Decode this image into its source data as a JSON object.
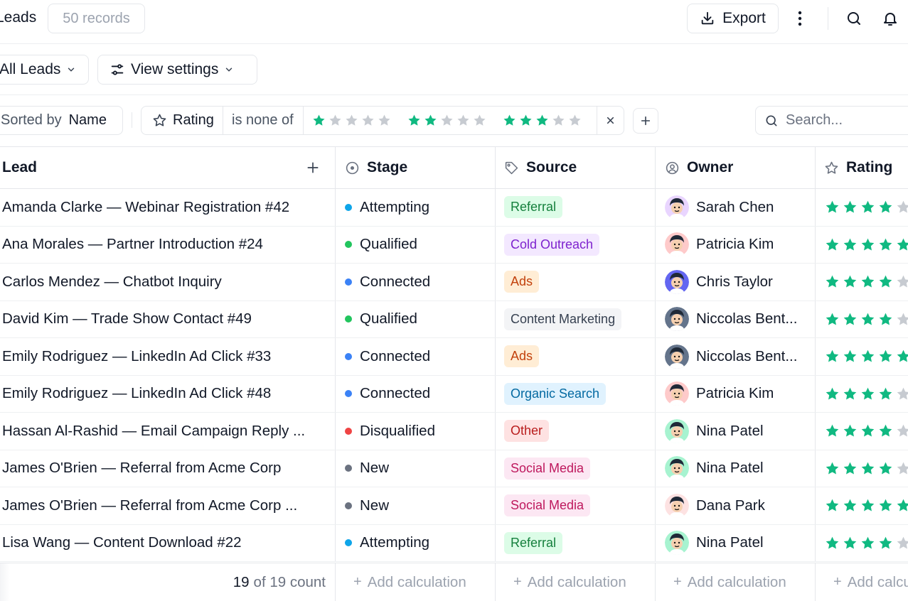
{
  "header": {
    "title": "Leads",
    "record_count": "50 records",
    "export_label": "Export"
  },
  "viewbar": {
    "view_label": "All Leads",
    "settings_label": "View settings"
  },
  "filterbar": {
    "sorted_by_label": "Sorted by",
    "sorted_by_value": "Name",
    "filter_field": "Rating",
    "filter_operator": "is none of",
    "filter_values": [
      1,
      2,
      3
    ],
    "search_placeholder": "Search..."
  },
  "columns": {
    "lead": "Lead",
    "stage": "Stage",
    "source": "Source",
    "owner": "Owner",
    "rating": "Rating"
  },
  "rows": [
    {
      "lead": "Amanda Clarke — Webinar Registration #42",
      "stage": "Attempting",
      "source": "Referral",
      "owner": "Sarah Chen",
      "rating": 4
    },
    {
      "lead": "Ana Morales — Partner Introduction #24",
      "stage": "Qualified",
      "source": "Cold Outreach",
      "owner": "Patricia Kim",
      "rating": 5
    },
    {
      "lead": "Carlos Mendez — Chatbot Inquiry",
      "stage": "Connected",
      "source": "Ads",
      "owner": "Chris Taylor",
      "rating": 4
    },
    {
      "lead": "David Kim — Trade Show Contact #49",
      "stage": "Qualified",
      "source": "Content Marketing",
      "owner": "Niccolas Bent...",
      "rating": 4
    },
    {
      "lead": "Emily Rodriguez — LinkedIn Ad Click #33",
      "stage": "Connected",
      "source": "Ads",
      "owner": "Niccolas Bent...",
      "rating": 5
    },
    {
      "lead": "Emily Rodriguez — LinkedIn Ad Click #48",
      "stage": "Connected",
      "source": "Organic Search",
      "owner": "Patricia Kim",
      "rating": 4
    },
    {
      "lead": "Hassan Al-Rashid — Email Campaign Reply ...",
      "stage": "Disqualified",
      "source": "Other",
      "owner": "Nina Patel",
      "rating": 4
    },
    {
      "lead": "James O'Brien — Referral from Acme Corp",
      "stage": "New",
      "source": "Social Media",
      "owner": "Nina Patel",
      "rating": 4
    },
    {
      "lead": "James O'Brien — Referral from Acme Corp ...",
      "stage": "New",
      "source": "Social Media",
      "owner": "Dana Park",
      "rating": 5
    },
    {
      "lead": "Lisa Wang — Content Download #22",
      "stage": "Attempting",
      "source": "Referral",
      "owner": "Nina Patel",
      "rating": 4
    }
  ],
  "footer": {
    "count_current": "19",
    "count_rest": "of 19 count",
    "add_calc": "Add calculation"
  },
  "colors": {
    "star_on": "#10b981",
    "star_off": "#c7cbd1",
    "stage": {
      "Attempting": "#0ea5e9",
      "Qualified": "#22c55e",
      "Connected": "#3b82f6",
      "Disqualified": "#ef4444",
      "New": "#6b7280"
    },
    "source": {
      "Referral": {
        "bg": "#dcfce7",
        "fg": "#15803d"
      },
      "Cold Outreach": {
        "bg": "#f3e8ff",
        "fg": "#7e22ce"
      },
      "Ads": {
        "bg": "#ffedd5",
        "fg": "#c2410c"
      },
      "Content Marketing": {
        "bg": "#f3f4f6",
        "fg": "#374151"
      },
      "Organic Search": {
        "bg": "#e0f2fe",
        "fg": "#0369a1"
      },
      "Other": {
        "bg": "#fee2e2",
        "fg": "#b91c1c"
      },
      "Social Media": {
        "bg": "#fce7f3",
        "fg": "#be185d"
      }
    },
    "owner": {
      "Sarah Chen": "#e9d5ff",
      "Patricia Kim": "#fecaca",
      "Chris Taylor": "#6366f1",
      "Niccolas Bent...": "#64748b",
      "Nina Patel": "#a7f3d0",
      "Dana Park": "#fde2e2"
    }
  }
}
